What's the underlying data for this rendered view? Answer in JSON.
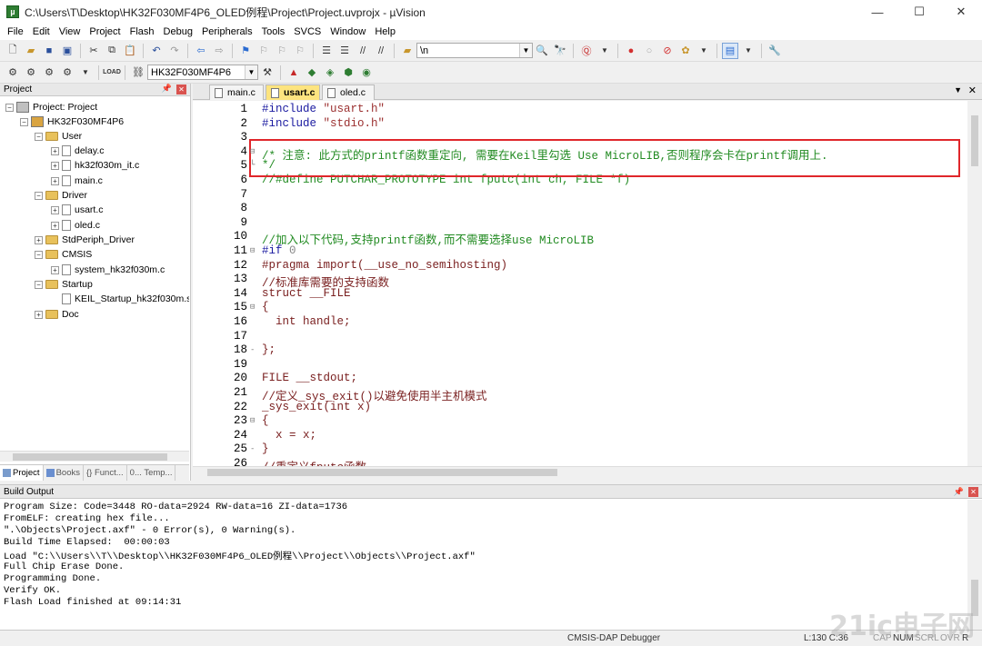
{
  "window": {
    "title": "C:\\Users\\T\\Desktop\\HK32F030MF4P6_OLED例程\\Project\\Project.uvprojx - µVision",
    "minimize": "—",
    "maximize": "☐",
    "close": "✕"
  },
  "menu": [
    "File",
    "Edit",
    "View",
    "Project",
    "Flash",
    "Debug",
    "Peripherals",
    "Tools",
    "SVCS",
    "Window",
    "Help"
  ],
  "toolbar": {
    "find_text": "\\n",
    "target": "HK32F030MF4P6"
  },
  "project_panel": {
    "title": "Project",
    "tree": {
      "root": "Project: Project",
      "target": "HK32F030MF4P6",
      "user": "User",
      "user_files": [
        "delay.c",
        "hk32f030m_it.c",
        "main.c"
      ],
      "driver": "Driver",
      "driver_files": [
        "usart.c",
        "oled.c"
      ],
      "stdperiph": "StdPeriph_Driver",
      "cmsis": "CMSIS",
      "cmsis_files": [
        "system_hk32f030m.c"
      ],
      "startup": "Startup",
      "startup_files": [
        "KEIL_Startup_hk32f030m.s"
      ],
      "doc": "Doc"
    },
    "tabs": [
      "Project",
      "Books",
      "{} Funct...",
      "0... Temp..."
    ]
  },
  "editor": {
    "tabs": [
      "main.c",
      "usart.c",
      "oled.c"
    ],
    "active_tab": "usart.c",
    "lines": [
      {
        "n": "1",
        "fold": "",
        "parts": [
          {
            "t": "#include ",
            "c": "pp"
          },
          {
            "t": "\"usart.h\"",
            "c": "str"
          }
        ]
      },
      {
        "n": "2",
        "fold": "",
        "parts": [
          {
            "t": "#include ",
            "c": "pp"
          },
          {
            "t": "\"stdio.h\"",
            "c": "str"
          }
        ]
      },
      {
        "n": "3",
        "fold": "",
        "parts": []
      },
      {
        "n": "4",
        "fold": "⊟",
        "parts": [
          {
            "t": "/* 注意: 此方式的printf函数重定向, 需要在Keil里勾选 Use MicroLIB,否则程序会卡在printf调用上.",
            "c": "cmt"
          }
        ]
      },
      {
        "n": "5",
        "fold": "└",
        "parts": [
          {
            "t": "*/",
            "c": "cmt"
          }
        ]
      },
      {
        "n": "6",
        "fold": "",
        "parts": [
          {
            "t": "//#define PUTCHAR_PROTOTYPE int fputc(int ch, FILE *f)",
            "c": "cmt"
          }
        ]
      },
      {
        "n": "7",
        "fold": "",
        "parts": []
      },
      {
        "n": "8",
        "fold": "",
        "parts": []
      },
      {
        "n": "9",
        "fold": "",
        "parts": []
      },
      {
        "n": "10",
        "fold": "",
        "parts": [
          {
            "t": "//加入以下代码,支持printf函数,而不需要选择use MicroLIB",
            "c": "cmt"
          }
        ]
      },
      {
        "n": "11",
        "fold": "⊟",
        "parts": [
          {
            "t": "#if ",
            "c": "pp"
          },
          {
            "t": "0",
            "c": "num"
          }
        ]
      },
      {
        "n": "12",
        "fold": "",
        "parts": [
          {
            "t": "#pragma import(__use_no_semihosting)",
            "c": "def"
          }
        ]
      },
      {
        "n": "13",
        "fold": "",
        "parts": [
          {
            "t": "//标准库需要的支持函数",
            "c": "def"
          }
        ]
      },
      {
        "n": "14",
        "fold": "",
        "parts": [
          {
            "t": "struct __FILE",
            "c": "def"
          }
        ]
      },
      {
        "n": "15",
        "fold": "⊟",
        "parts": [
          {
            "t": "{",
            "c": "def"
          }
        ]
      },
      {
        "n": "16",
        "fold": "",
        "parts": [
          {
            "t": "  int handle;",
            "c": "def"
          }
        ]
      },
      {
        "n": "17",
        "fold": "",
        "parts": []
      },
      {
        "n": "18",
        "fold": "-",
        "parts": [
          {
            "t": "};",
            "c": "def"
          }
        ]
      },
      {
        "n": "19",
        "fold": "",
        "parts": []
      },
      {
        "n": "20",
        "fold": "",
        "parts": [
          {
            "t": "FILE __stdout;",
            "c": "def"
          }
        ]
      },
      {
        "n": "21",
        "fold": "",
        "parts": [
          {
            "t": "//定义_sys_exit()以避免使用半主机模式",
            "c": "def"
          }
        ]
      },
      {
        "n": "22",
        "fold": "",
        "parts": [
          {
            "t": "_sys_exit(int x)",
            "c": "def"
          }
        ]
      },
      {
        "n": "23",
        "fold": "⊟",
        "parts": [
          {
            "t": "{",
            "c": "def"
          }
        ]
      },
      {
        "n": "24",
        "fold": "",
        "parts": [
          {
            "t": "  x = x;",
            "c": "def"
          }
        ]
      },
      {
        "n": "25",
        "fold": "-",
        "parts": [
          {
            "t": "}",
            "c": "def"
          }
        ]
      },
      {
        "n": "26",
        "fold": "",
        "parts": [
          {
            "t": "//重定义fputc函数",
            "c": "def"
          }
        ]
      }
    ]
  },
  "build_output": {
    "title": "Build Output",
    "lines": [
      "Program Size: Code=3448 RO-data=2924 RW-data=16 ZI-data=1736",
      "FromELF: creating hex file...",
      "\".\\Objects\\Project.axf\" - 0 Error(s), 0 Warning(s).",
      "Build Time Elapsed:  00:00:03",
      "Load \"C:\\\\Users\\\\T\\\\Desktop\\\\HK32F030MF4P6_OLED例程\\\\Project\\\\Objects\\\\Project.axf\"",
      "Full Chip Erase Done.",
      "Programming Done.",
      "Verify OK.",
      "Flash Load finished at 09:14:31"
    ]
  },
  "status": {
    "debugger": "CMSIS-DAP Debugger",
    "position": "L:130 C:36",
    "caps": "CAP",
    "num": "NUM",
    "scrl": "SCRL",
    "ovr": "OVR",
    "rw": "R"
  },
  "watermark": "21ic电子网",
  "colors": {
    "highlight_box": "#e0262b",
    "comment": "#228b22",
    "string": "#9b2f2f",
    "active_tab": "#fde47f"
  }
}
